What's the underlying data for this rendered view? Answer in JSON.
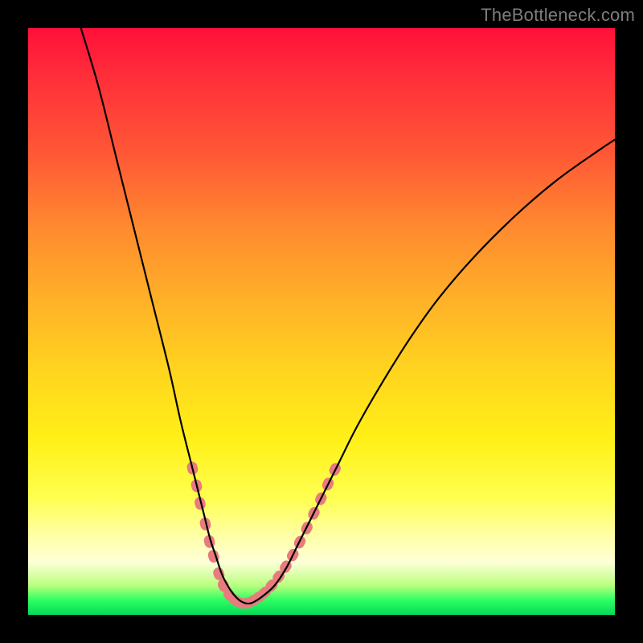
{
  "watermark": "TheBottleneck.com",
  "chart_data": {
    "type": "line",
    "title": "",
    "xlabel": "",
    "ylabel": "",
    "xlim": [
      0,
      100
    ],
    "ylim": [
      0,
      100
    ],
    "series": [
      {
        "name": "bottleneck-curve",
        "x": [
          9,
          12,
          15,
          18,
          21,
          24,
          26,
          28,
          30,
          31,
          32,
          33,
          34,
          35,
          36,
          37,
          38,
          39,
          40,
          42,
          44,
          46,
          48,
          50,
          53,
          56,
          60,
          65,
          70,
          76,
          83,
          90,
          97,
          100
        ],
        "y": [
          100,
          90,
          78,
          66,
          54,
          42,
          33,
          25,
          17,
          13,
          10,
          7,
          5,
          3.5,
          2.5,
          2,
          2,
          2.5,
          3.2,
          5,
          8,
          12,
          16,
          20,
          26,
          32,
          39,
          47,
          54,
          61,
          68,
          74,
          79,
          81
        ]
      }
    ],
    "markers": {
      "name": "highlight-segments",
      "color": "#e77b7d",
      "points": [
        {
          "x": 28.0,
          "y": 25.0
        },
        {
          "x": 28.7,
          "y": 22.0
        },
        {
          "x": 29.3,
          "y": 19.0
        },
        {
          "x": 30.2,
          "y": 15.5
        },
        {
          "x": 30.9,
          "y": 12.5
        },
        {
          "x": 31.6,
          "y": 10.0
        },
        {
          "x": 32.5,
          "y": 7.0
        },
        {
          "x": 33.3,
          "y": 5.0
        },
        {
          "x": 34.3,
          "y": 3.4
        },
        {
          "x": 35.3,
          "y": 2.5
        },
        {
          "x": 36.3,
          "y": 2.0
        },
        {
          "x": 37.3,
          "y": 2.0
        },
        {
          "x": 38.3,
          "y": 2.4
        },
        {
          "x": 39.3,
          "y": 3.0
        },
        {
          "x": 40.3,
          "y": 3.8
        },
        {
          "x": 41.5,
          "y": 5.0
        },
        {
          "x": 42.7,
          "y": 6.5
        },
        {
          "x": 43.9,
          "y": 8.2
        },
        {
          "x": 45.1,
          "y": 10.2
        },
        {
          "x": 46.3,
          "y": 12.4
        },
        {
          "x": 47.5,
          "y": 14.8
        },
        {
          "x": 48.7,
          "y": 17.3
        },
        {
          "x": 49.9,
          "y": 19.8
        },
        {
          "x": 51.1,
          "y": 22.3
        },
        {
          "x": 52.3,
          "y": 24.8
        }
      ]
    }
  }
}
